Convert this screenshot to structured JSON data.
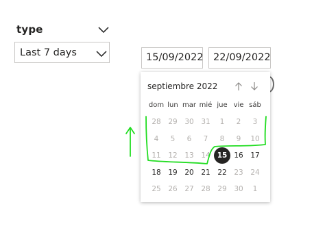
{
  "filter": {
    "title": "type",
    "dropdown_value": "Last 7 days"
  },
  "date_range": {
    "start": "15/09/2022",
    "end": "22/09/2022"
  },
  "calendar": {
    "month_label": "septiembre 2022",
    "weekdays": [
      "dom",
      "lun",
      "mar",
      "mié",
      "jue",
      "vie",
      "sáb"
    ],
    "weeks": [
      [
        {
          "d": "28",
          "muted": true
        },
        {
          "d": "29",
          "muted": true
        },
        {
          "d": "30",
          "muted": true
        },
        {
          "d": "31",
          "muted": true
        },
        {
          "d": "1",
          "muted": true
        },
        {
          "d": "2",
          "muted": true
        },
        {
          "d": "3",
          "muted": true
        }
      ],
      [
        {
          "d": "4",
          "muted": true
        },
        {
          "d": "5",
          "muted": true
        },
        {
          "d": "6",
          "muted": true
        },
        {
          "d": "7",
          "muted": true
        },
        {
          "d": "8",
          "muted": true
        },
        {
          "d": "9",
          "muted": true
        },
        {
          "d": "10",
          "muted": true
        }
      ],
      [
        {
          "d": "11",
          "muted": true
        },
        {
          "d": "12",
          "muted": true
        },
        {
          "d": "13",
          "muted": true
        },
        {
          "d": "14",
          "muted": true
        },
        {
          "d": "15",
          "selected": true
        },
        {
          "d": "16"
        },
        {
          "d": "17"
        }
      ],
      [
        {
          "d": "18"
        },
        {
          "d": "19"
        },
        {
          "d": "20"
        },
        {
          "d": "21"
        },
        {
          "d": "22"
        },
        {
          "d": "23",
          "muted": true
        },
        {
          "d": "24",
          "muted": true
        }
      ],
      [
        {
          "d": "25",
          "muted": true
        },
        {
          "d": "26",
          "muted": true
        },
        {
          "d": "27",
          "muted": true
        },
        {
          "d": "28",
          "muted": true
        },
        {
          "d": "29",
          "muted": true
        },
        {
          "d": "30",
          "muted": true
        },
        {
          "d": "1",
          "muted": true
        }
      ]
    ]
  },
  "icons": {
    "filter_collapse": "chevron-down-icon",
    "dropdown": "chevron-down-icon",
    "prev_month": "arrow-up-icon",
    "next_month": "arrow-down-icon"
  },
  "colors": {
    "selected_day": "#252423",
    "muted_day": "#b3b0ad",
    "annotation": "#22dd22"
  }
}
